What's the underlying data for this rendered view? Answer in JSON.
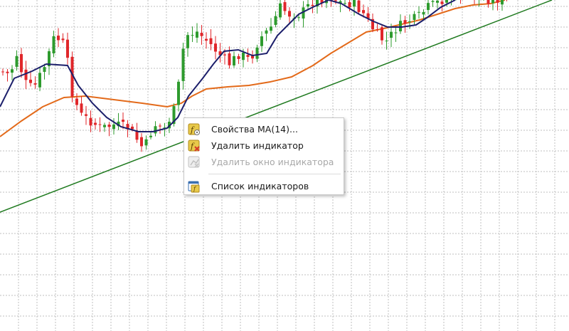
{
  "colors": {
    "background": "#ffffff",
    "grid": "#bfbfbf",
    "bull_candle": "#2e9b2e",
    "bear_candle": "#e0262a",
    "ma_fast": "#1c1f6b",
    "ma_slow": "#e36a1a",
    "trendline": "#1f7a1f",
    "menu_icon_fill": "#e8c94a",
    "menu_icon_delete": "#d63a2a"
  },
  "chart": {
    "moving_averages": [
      {
        "name": "fast-ma",
        "period": 14
      },
      {
        "name": "slow-ma"
      }
    ],
    "has_trendline": true,
    "grid": true
  },
  "context_menu": {
    "items": [
      {
        "label": "Свойства MA(14)...",
        "icon": "indicator-properties-icon",
        "enabled": true
      },
      {
        "label": "Удалить индикатор",
        "icon": "delete-indicator-icon",
        "enabled": true
      },
      {
        "label": "Удалить окно индикатора",
        "icon": "delete-indicator-window-icon",
        "enabled": false
      },
      {
        "label": "Список индикаторов",
        "icon": "indicator-list-icon",
        "enabled": true
      }
    ]
  }
}
